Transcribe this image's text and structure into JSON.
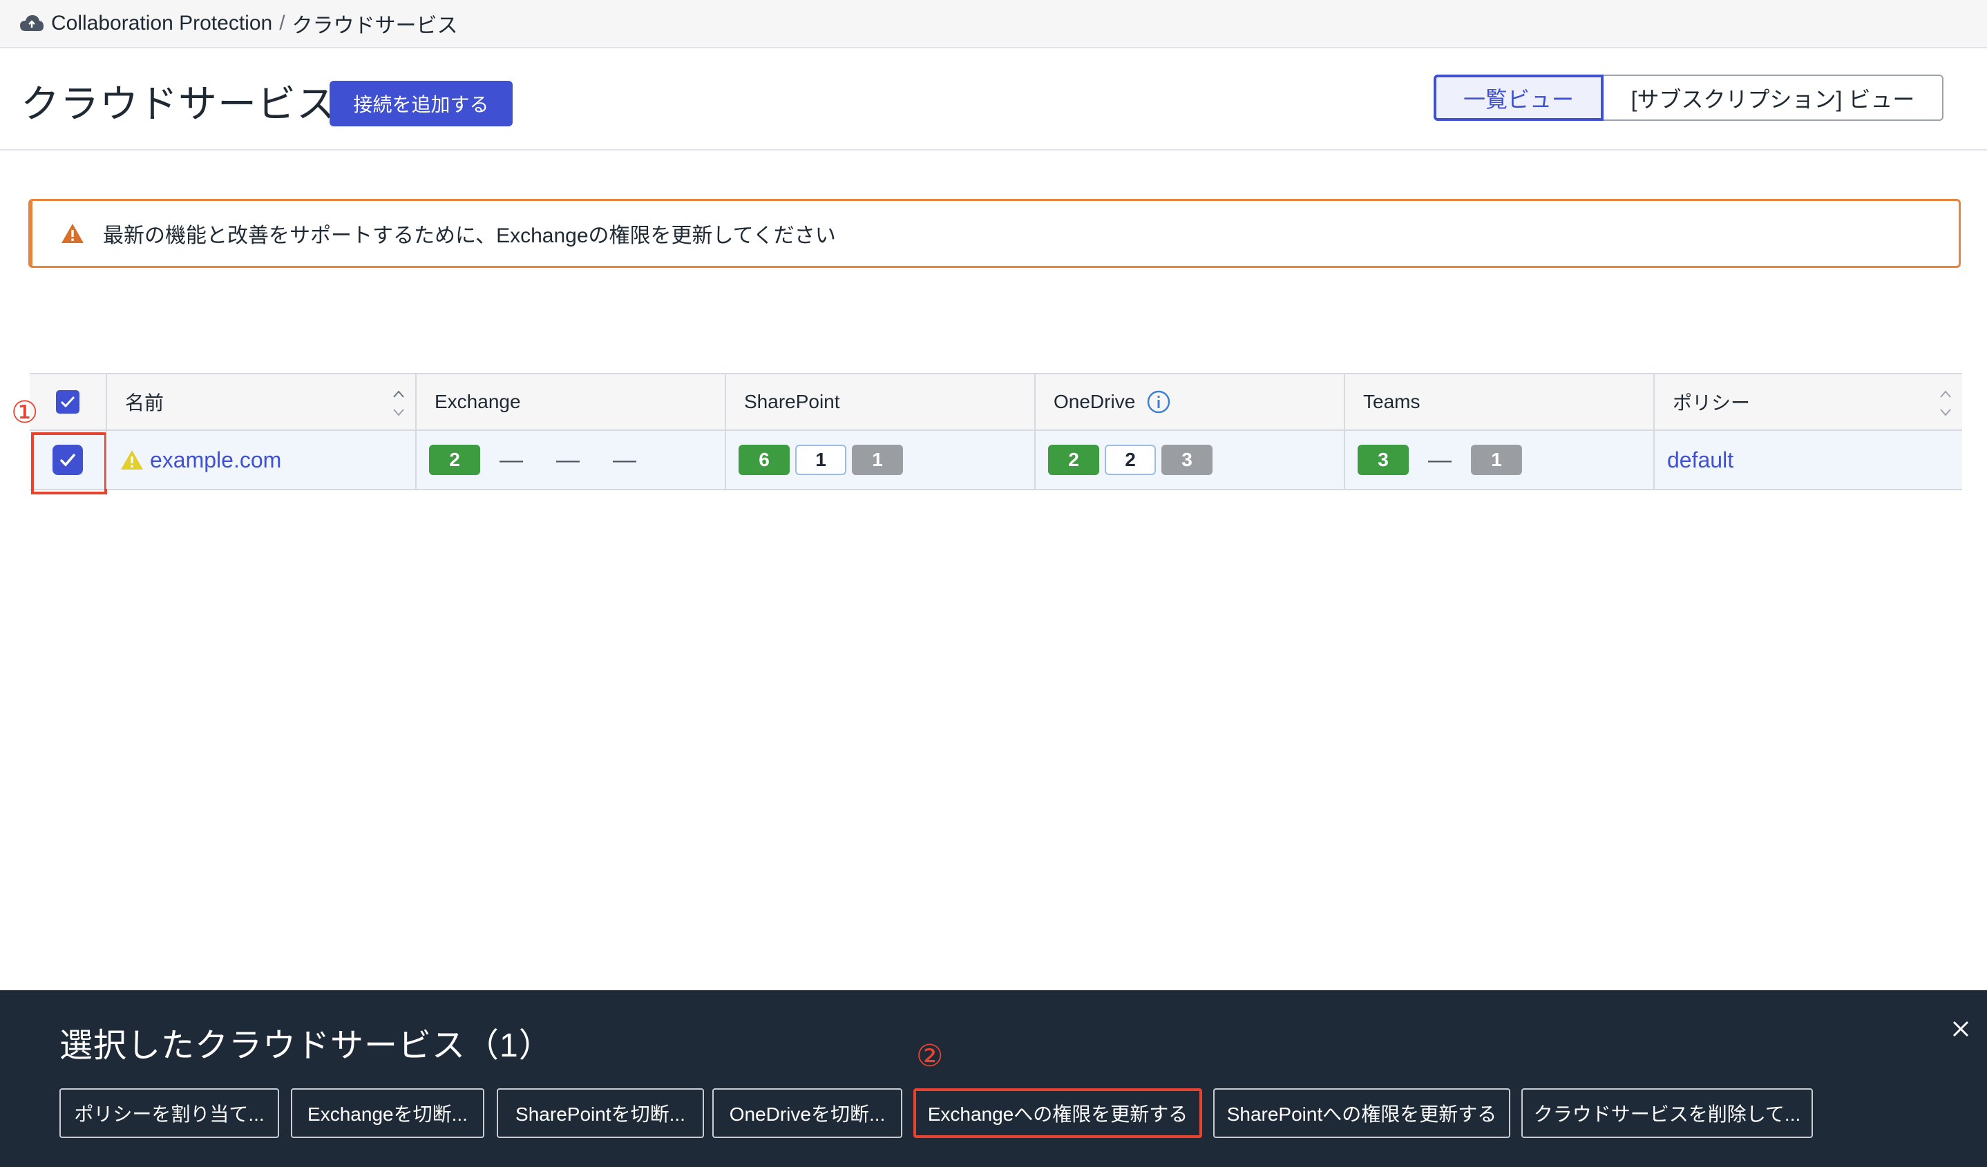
{
  "breadcrumb": {
    "root": "Collaboration Protection",
    "separator": "/",
    "current": "クラウドサービス"
  },
  "header": {
    "title": "クラウドサービス",
    "add_button": "接続を追加する",
    "view_list": "一覧ビュー",
    "view_subscription": "[サブスクリプション] ビュー"
  },
  "alert": {
    "message": "最新の機能と改善をサポートするために、Exchangeの権限を更新してください"
  },
  "table": {
    "columns": [
      "名前",
      "Exchange",
      "SharePoint",
      "OneDrive",
      "Teams",
      "ポリシー"
    ],
    "row": {
      "name": "example.com",
      "exchange": {
        "badge": "2",
        "dashes": [
          "—",
          "—",
          "—"
        ]
      },
      "sharepoint": [
        "6",
        "1",
        "1"
      ],
      "onedrive": [
        "2",
        "2",
        "3"
      ],
      "teams": {
        "first": "3",
        "dash": "—",
        "last": "1"
      },
      "policy": "default"
    }
  },
  "annotations": {
    "step1": "①",
    "step2": "②"
  },
  "action_panel": {
    "title": "選択したクラウドサービス（1）",
    "buttons": [
      "ポリシーを割り当て...",
      "Exchangeを切断...",
      "SharePointを切断...",
      "OneDriveを切断...",
      "Exchangeへの権限を更新する",
      "SharePointへの権限を更新する",
      "クラウドサービスを削除して..."
    ]
  },
  "colors": {
    "accent": "#3f51d2",
    "success": "#3d9c3f",
    "warning": "#e8833a",
    "annotation": "#e8432e",
    "panel": "#1f2a38"
  }
}
